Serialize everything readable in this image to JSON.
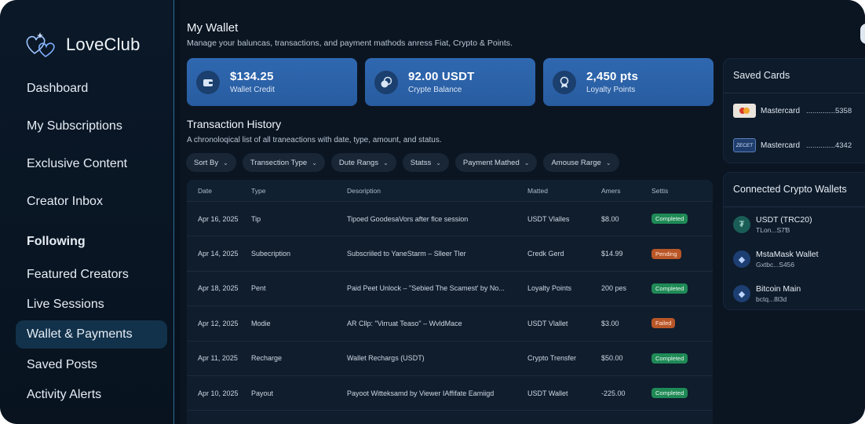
{
  "app": {
    "name": "LoveClub"
  },
  "sidebar": {
    "items": [
      {
        "label": "Dashboard"
      },
      {
        "label": "My Subscriptions"
      },
      {
        "label": "Exclusive Content"
      },
      {
        "label": "Creator Inbox"
      }
    ],
    "section": "Following",
    "following_items": [
      {
        "label": "Featured Creators"
      },
      {
        "label": "Live Sessions"
      },
      {
        "label": "Wallet & Payments",
        "active": true
      },
      {
        "label": "Saved Posts"
      },
      {
        "label": "Activity Alerts"
      }
    ]
  },
  "wallet": {
    "title": "My Wallet",
    "subtitle": "Manage your baluncas, transactions, and payment mathods anress Fiat, Crypto & Points.",
    "stats": [
      {
        "icon": "wallet-icon",
        "value": "$134.25",
        "label": "Wallet Credit"
      },
      {
        "icon": "crypto-coin-icon",
        "value": "92.00 USDT",
        "label": "Crypte Balance"
      },
      {
        "icon": "medal-icon",
        "value": "2,450 pts",
        "label": "Loyalty Points"
      }
    ]
  },
  "transactions": {
    "title": "Transaction History",
    "subtitle": "A chronoloqical list of all traneactions with date, type, amount, and status.",
    "filters": [
      "Sort By",
      "Transection Type",
      "Dute Rangs",
      "Statss",
      "Payment Mathed",
      "Amouse Rarge"
    ],
    "columns": [
      "Date",
      "Type",
      "Desoription",
      "Matted",
      "Amers",
      "Settis"
    ],
    "rows": [
      {
        "date": "Apr 16, 2025",
        "type": "Tip",
        "desc": "Tipoed GoodesaVors after flce session",
        "method": "USDT Vlalles",
        "amount": "$8.00",
        "status": "Completed",
        "status_color": "green"
      },
      {
        "date": "Apr 14, 2025",
        "type": "Subecription",
        "desc": "Subscriiled to YaneStarm – Slleer Tler",
        "method": "Credk Gerd",
        "amount": "$14.99",
        "status": "Pending",
        "status_color": "orange"
      },
      {
        "date": "Apr 18, 2025",
        "type": "Pent",
        "desc": "Paid Peet Unlock – \"Sebied The Scamest' by No...",
        "method": "Loyalty Points",
        "amount": "200 pes",
        "status": "Completed",
        "status_color": "green"
      },
      {
        "date": "Apr 12, 2025",
        "type": "Modie",
        "desc": "AR Cllp: \"Virruat Teaso\" – WvldMace",
        "method": "USDT Vlallet",
        "amount": "$3.00",
        "status": "Failed",
        "status_color": "orange"
      },
      {
        "date": "Apr 11, 2025",
        "type": "Recharge",
        "desc": "Wallet Rechargs (USDT)",
        "method": "Crypto Trensfer",
        "amount": "$50.00",
        "status": "Completed",
        "status_color": "green"
      },
      {
        "date": "Apr 10, 2025",
        "type": "Payout",
        "desc": "Payoot Witteksamd by Viewer IAffifate Eamiigd",
        "method": "USDT Wallet",
        "amount": "-225.00",
        "status": "Completed",
        "status_color": "green"
      }
    ]
  },
  "saved_cards": {
    "title": "Saved Cards",
    "cards": [
      {
        "brand": "Mastercard",
        "number": "..............5358",
        "logo": "mastercard-logo-icon"
      },
      {
        "brand": "Mastercard",
        "number": "..............4342",
        "logo": "card-logo-icon",
        "logo_text": "ZECET"
      }
    ]
  },
  "crypto_wallets": {
    "title": "Connected Crypto Wallets",
    "wallets": [
      {
        "name": "USDT (TRC20)",
        "address": "TLon...S7Ɓ",
        "icon": "tether-icon"
      },
      {
        "name": "MstaMask Wallet",
        "address": "Gxtbc...S456",
        "icon": "ethereum-icon"
      },
      {
        "name": "Bitcoin Main",
        "address": "bctq...8l3d",
        "icon": "ethereum-icon"
      }
    ]
  },
  "colors": {
    "accent": "#2f68b0",
    "active_nav": "#12324b",
    "success": "#1f8a56",
    "warning": "#b85627"
  }
}
